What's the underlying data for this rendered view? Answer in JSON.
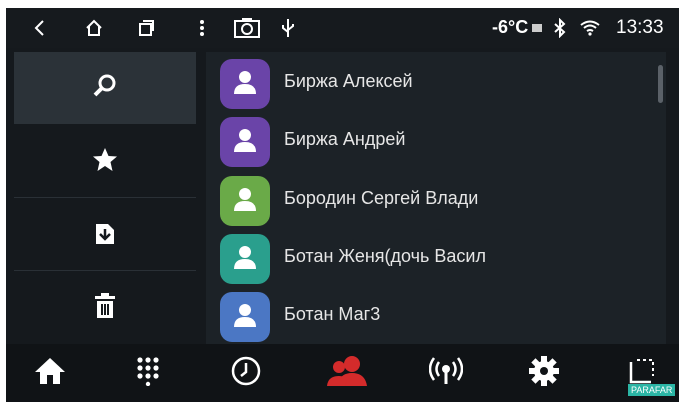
{
  "status_bar": {
    "icons": [
      "back-icon",
      "home-outline-icon",
      "recents-icon",
      "more-vert-icon",
      "camera-icon",
      "usb-icon",
      "sim-icon",
      "bluetooth-icon",
      "wifi-icon"
    ],
    "temperature": "-6°C",
    "time": "13:33"
  },
  "sidebar": {
    "items": [
      {
        "icon": "search-icon",
        "selected": true
      },
      {
        "icon": "star-icon",
        "selected": false
      },
      {
        "icon": "import-icon",
        "selected": false
      },
      {
        "icon": "trash-icon",
        "selected": false
      }
    ]
  },
  "contacts": [
    {
      "name": "Биржа Алексей",
      "color": "#6a44a8"
    },
    {
      "name": "Биржа Андрей",
      "color": "#6a44a8"
    },
    {
      "name": "Бородин Сергей Влади",
      "color": "#6aaa48"
    },
    {
      "name": "Ботан Женя(дочь Васил",
      "color": "#2a9f8d"
    },
    {
      "name": "Ботан Маг3",
      "color": "#4b77c4"
    }
  ],
  "bottom_nav": [
    {
      "icon": "home-icon",
      "active": false
    },
    {
      "icon": "dialpad-icon",
      "active": false
    },
    {
      "icon": "clock-icon",
      "active": false
    },
    {
      "icon": "contacts-icon",
      "active": true
    },
    {
      "icon": "radio-icon",
      "active": false
    },
    {
      "icon": "settings-icon",
      "active": false
    },
    {
      "icon": "screen-icon",
      "active": false
    }
  ],
  "colors": {
    "accent": "#d42b2b",
    "background": "#15191d",
    "list_bg": "#1c2227"
  },
  "watermark": "PARAFAR"
}
